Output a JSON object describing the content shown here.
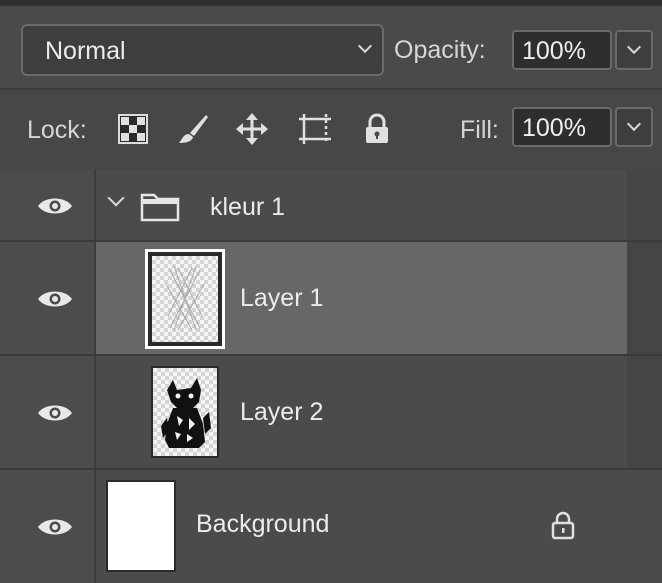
{
  "blend": {
    "mode": "Normal"
  },
  "opacity": {
    "label": "Opacity:",
    "value": "100%"
  },
  "lock": {
    "label": "Lock:"
  },
  "fill": {
    "label": "Fill:",
    "value": "100%"
  },
  "layers": [
    {
      "name": "kleur 1",
      "type": "group",
      "expanded": true,
      "visible": true
    },
    {
      "name": "Layer 1",
      "type": "pixel",
      "selected": true,
      "visible": true
    },
    {
      "name": "Layer 2",
      "type": "pixel",
      "selected": false,
      "visible": true
    },
    {
      "name": "Background",
      "type": "background",
      "locked": true,
      "visible": true
    }
  ],
  "icons": [
    "eye-icon",
    "folder-icon",
    "chevron-down-icon",
    "lock-icon",
    "lock-transparent-icon",
    "lock-paint-icon",
    "lock-position-icon",
    "lock-artboard-icon"
  ],
  "colors": {
    "panel": "#484848",
    "selected_row": "#676767",
    "field": "#2e2e2e",
    "text": "#ececec"
  }
}
